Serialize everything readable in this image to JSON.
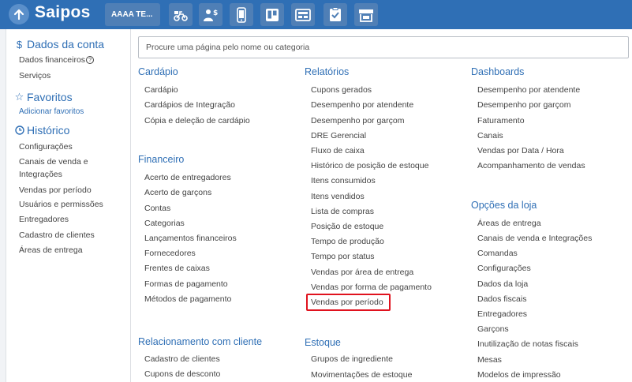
{
  "topbar": {
    "logo": "Saipos",
    "store_label": "AAAA TE...",
    "icons": [
      "delivery-scooter-icon",
      "person-dollar-icon",
      "phone-app-icon",
      "kanban-icon",
      "cash-register-icon",
      "clipboard-check-icon",
      "storefront-icon"
    ],
    "colors": {
      "bar": "#2f6fb5",
      "button": "#4f7fb6",
      "highlight": "#e0121e"
    }
  },
  "sidebar": {
    "account_title": "Dados da conta",
    "account_items": [
      "Dados financeiros",
      "Serviços"
    ],
    "favorites_title": "Favoritos",
    "add_favorites": "Adicionar favoritos",
    "history_title": "Histórico",
    "history_items": [
      "Configurações",
      "Canais de venda e",
      "Integrações",
      "Vendas por período",
      "Usuários e permissões",
      "Entregadores",
      "Cadastro de clientes",
      "Áreas de entrega"
    ]
  },
  "search": {
    "placeholder": "Procure uma página pelo nome ou categoria"
  },
  "sections": {
    "cardapio": {
      "title": "Cardápio",
      "items": [
        "Cardápio",
        "Cardápios de Integração",
        "Cópia e deleção de cardápio"
      ]
    },
    "financeiro": {
      "title": "Financeiro",
      "items": [
        "Acerto de entregadores",
        "Acerto de garçons",
        "Contas",
        "Categorias",
        "Lançamentos financeiros",
        "Fornecedores",
        "Frentes de caixas",
        "Formas de pagamento",
        "Métodos de pagamento"
      ]
    },
    "relacionamento": {
      "title": "Relacionamento com cliente",
      "items": [
        "Cadastro de clientes",
        "Cupons de desconto"
      ]
    },
    "relatorios": {
      "title": "Relatórios",
      "items": [
        "Cupons gerados",
        "Desempenho por atendente",
        "Desempenho por garçom",
        "DRE Gerencial",
        "Fluxo de caixa",
        "Histórico de posição de estoque",
        "Itens consumidos",
        "Itens vendidos",
        "Lista de compras",
        "Posição de estoque",
        "Tempo de produção",
        "Tempo por status",
        "Vendas por área de entrega",
        "Vendas por forma de pagamento",
        "Vendas por período"
      ]
    },
    "estoque": {
      "title": "Estoque",
      "items": [
        "Grupos de ingrediente",
        "Movimentações de estoque"
      ]
    },
    "dashboards": {
      "title": "Dashboards",
      "items": [
        "Desempenho por atendente",
        "Desempenho por garçom",
        "Faturamento",
        "Canais",
        "Vendas por Data / Hora",
        "Acompanhamento de vendas"
      ]
    },
    "opcoes": {
      "title": "Opções da loja",
      "items": [
        "Áreas de entrega",
        "Canais de venda e Integrações",
        "Comandas",
        "Configurações",
        "Dados da loja",
        "Dados fiscais",
        "Entregadores",
        "Garçons",
        "Inutilização de notas fiscais",
        "Mesas",
        "Modelos de impressão"
      ]
    }
  }
}
